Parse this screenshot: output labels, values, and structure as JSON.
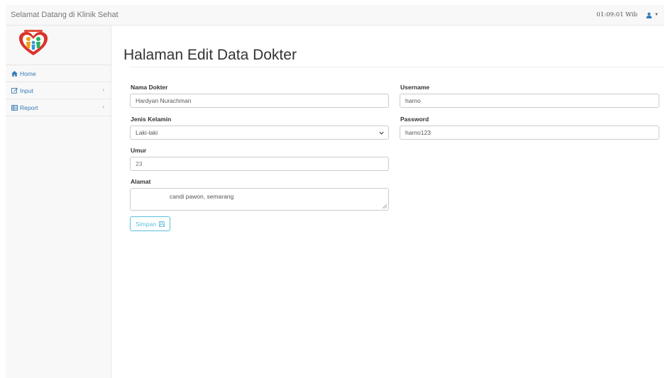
{
  "header": {
    "brand": "Selamat Datang di Klinik Sehat",
    "time": "01:09:01 Wib",
    "user_icon": "user-icon"
  },
  "sidebar": {
    "items": [
      {
        "label": "Home",
        "icon": "home-icon",
        "has_submenu": false
      },
      {
        "label": "Input",
        "icon": "edit-icon",
        "has_submenu": true
      },
      {
        "label": "Report",
        "icon": "table-icon",
        "has_submenu": true
      }
    ]
  },
  "main": {
    "title": "Halaman Edit Data Dokter"
  },
  "form": {
    "nama_label": "Nama Dokter",
    "nama_value": "Hardyan Nurachman",
    "jk_label": "Jenis Kelamin",
    "jk_value": "Laki-laki",
    "umur_label": "Umur",
    "umur_value": "23",
    "alamat_label": "Alamat",
    "alamat_value": "candi pawon, semarang",
    "username_label": "Username",
    "username_value": "harno",
    "password_label": "Password",
    "password_value": "harno123",
    "submit_label": "Simpan"
  },
  "colors": {
    "link": "#337ab7",
    "info_button": "#5bc0de",
    "navbar_bg": "#f8f8f8"
  }
}
